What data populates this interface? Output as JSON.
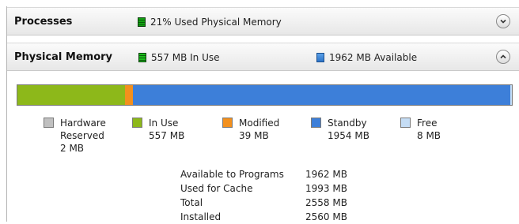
{
  "processes": {
    "title": "Processes",
    "stat": "21% Used Physical Memory"
  },
  "physical_memory": {
    "title": "Physical Memory",
    "in_use_stat": "557 MB In Use",
    "available_stat": "1962 MB Available"
  },
  "bar": {
    "segments": [
      {
        "name": "Hardware Reserved",
        "mb": 2,
        "color": "#c0c0c0"
      },
      {
        "name": "In Use",
        "mb": 557,
        "color": "#8db81a"
      },
      {
        "name": "Modified",
        "mb": 39,
        "color": "#f3901d"
      },
      {
        "name": "Standby",
        "mb": 1954,
        "color": "#3d7fd9"
      },
      {
        "name": "Free",
        "mb": 8,
        "color": "#c5ddf5"
      }
    ]
  },
  "legend": [
    {
      "label1": "Hardware",
      "label2": "Reserved",
      "value": "2 MB",
      "color": "#c0c0c0"
    },
    {
      "label1": "In Use",
      "label2": "",
      "value": "557 MB",
      "color": "#8db81a"
    },
    {
      "label1": "Modified",
      "label2": "",
      "value": "39 MB",
      "color": "#f3901d"
    },
    {
      "label1": "Standby",
      "label2": "",
      "value": "1954 MB",
      "color": "#3d7fd9"
    },
    {
      "label1": "Free",
      "label2": "",
      "value": "8 MB",
      "color": "#c5ddf5"
    }
  ],
  "summary": [
    {
      "label": "Available to Programs",
      "value": "1962 MB"
    },
    {
      "label": "Used for Cache",
      "value": "1993 MB"
    },
    {
      "label": "Total",
      "value": "2558 MB"
    },
    {
      "label": "Installed",
      "value": "2560 MB"
    }
  ],
  "icons": {
    "processes_toggle": "chevron-down-icon",
    "physical_toggle": "chevron-up-icon"
  }
}
